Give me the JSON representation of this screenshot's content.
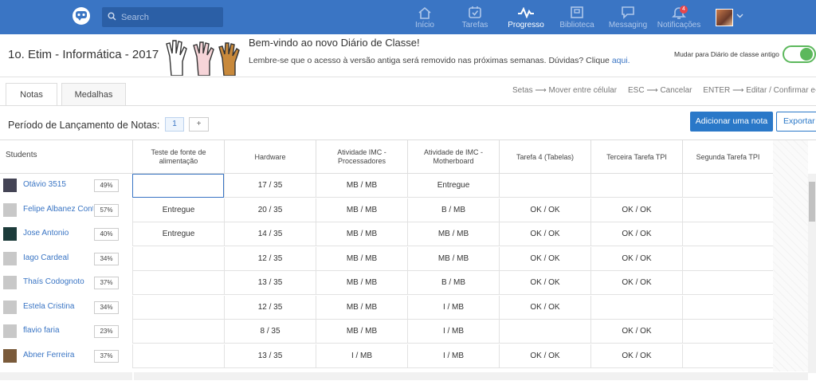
{
  "search": {
    "placeholder": "Search"
  },
  "nav": [
    {
      "label": "Início",
      "icon": "home-icon"
    },
    {
      "label": "Tarefas",
      "icon": "assignment-icon"
    },
    {
      "label": "Progresso",
      "icon": "progress-icon"
    },
    {
      "label": "Biblioteca",
      "icon": "library-icon"
    },
    {
      "label": "Messaging",
      "icon": "message-icon"
    },
    {
      "label": "Notificações",
      "icon": "bell-icon"
    }
  ],
  "notification_count": "4",
  "class_name": "1o. Etim - Informática - 2017",
  "banner": {
    "title": "Bem-vindo ao novo Diário de Classe!",
    "text": "Lembre-se que o acesso à versão antiga será removido nas próximas semanas. Dúvidas? Clique ",
    "link": "aqui."
  },
  "switch_label": "Mudar para Diário de classe antigo",
  "tabs": [
    "Notas",
    "Medalhas"
  ],
  "shortcuts": {
    "arrows": "Setas",
    "arrows_desc": "Mover entre célular",
    "esc": "ESC",
    "esc_desc": "Cancelar",
    "enter": "ENTER",
    "enter_desc": "Editar / Confirmar e-ma"
  },
  "period_label": "Período de Lançamento de Notas:",
  "period_value": "1",
  "period_add": "+",
  "add_grade_button": "Adicionar uma nota",
  "export_button": "Exportar",
  "students_header": "Students",
  "columns": [
    "Teste de fonte de alimentação",
    "Hardware",
    "Atividade IMC - Processadores",
    "Atividade de IMC - Motherboard",
    "Tarefa 4 (Tabelas)",
    "Terceira Tarefa TPI",
    "Segunda Tarefa TPI"
  ],
  "students": [
    {
      "name": "Otávio 3515",
      "pct": "49%",
      "grades": [
        "",
        "17 / 35",
        "MB / MB",
        "Entregue",
        "",
        "",
        ""
      ]
    },
    {
      "name": "Felipe Albanez Cont",
      "pct": "57%",
      "grades": [
        "Entregue",
        "20 / 35",
        "MB / MB",
        "B / MB",
        "OK / OK",
        "OK / OK",
        ""
      ]
    },
    {
      "name": "Jose Antonio",
      "pct": "40%",
      "grades": [
        "Entregue",
        "14 / 35",
        "MB / MB",
        "MB / MB",
        "OK / OK",
        "OK / OK",
        ""
      ]
    },
    {
      "name": "Iago Cardeal",
      "pct": "34%",
      "grades": [
        "",
        "12 / 35",
        "MB / MB",
        "MB / MB",
        "OK / OK",
        "OK / OK",
        ""
      ]
    },
    {
      "name": "Thaís Codognoto",
      "pct": "37%",
      "grades": [
        "",
        "13 / 35",
        "MB / MB",
        "B / MB",
        "OK / OK",
        "OK / OK",
        ""
      ]
    },
    {
      "name": "Estela Cristina",
      "pct": "34%",
      "grades": [
        "",
        "12 / 35",
        "MB / MB",
        "I / MB",
        "OK / OK",
        "",
        ""
      ]
    },
    {
      "name": "flavio faria",
      "pct": "23%",
      "grades": [
        "",
        "8 / 35",
        "MB / MB",
        "I / MB",
        "",
        "OK / OK",
        ""
      ]
    },
    {
      "name": "Abner Ferreira",
      "pct": "37%",
      "grades": [
        "",
        "13 / 35",
        "I / MB",
        "I / MB",
        "OK / OK",
        "OK / OK",
        ""
      ]
    }
  ]
}
